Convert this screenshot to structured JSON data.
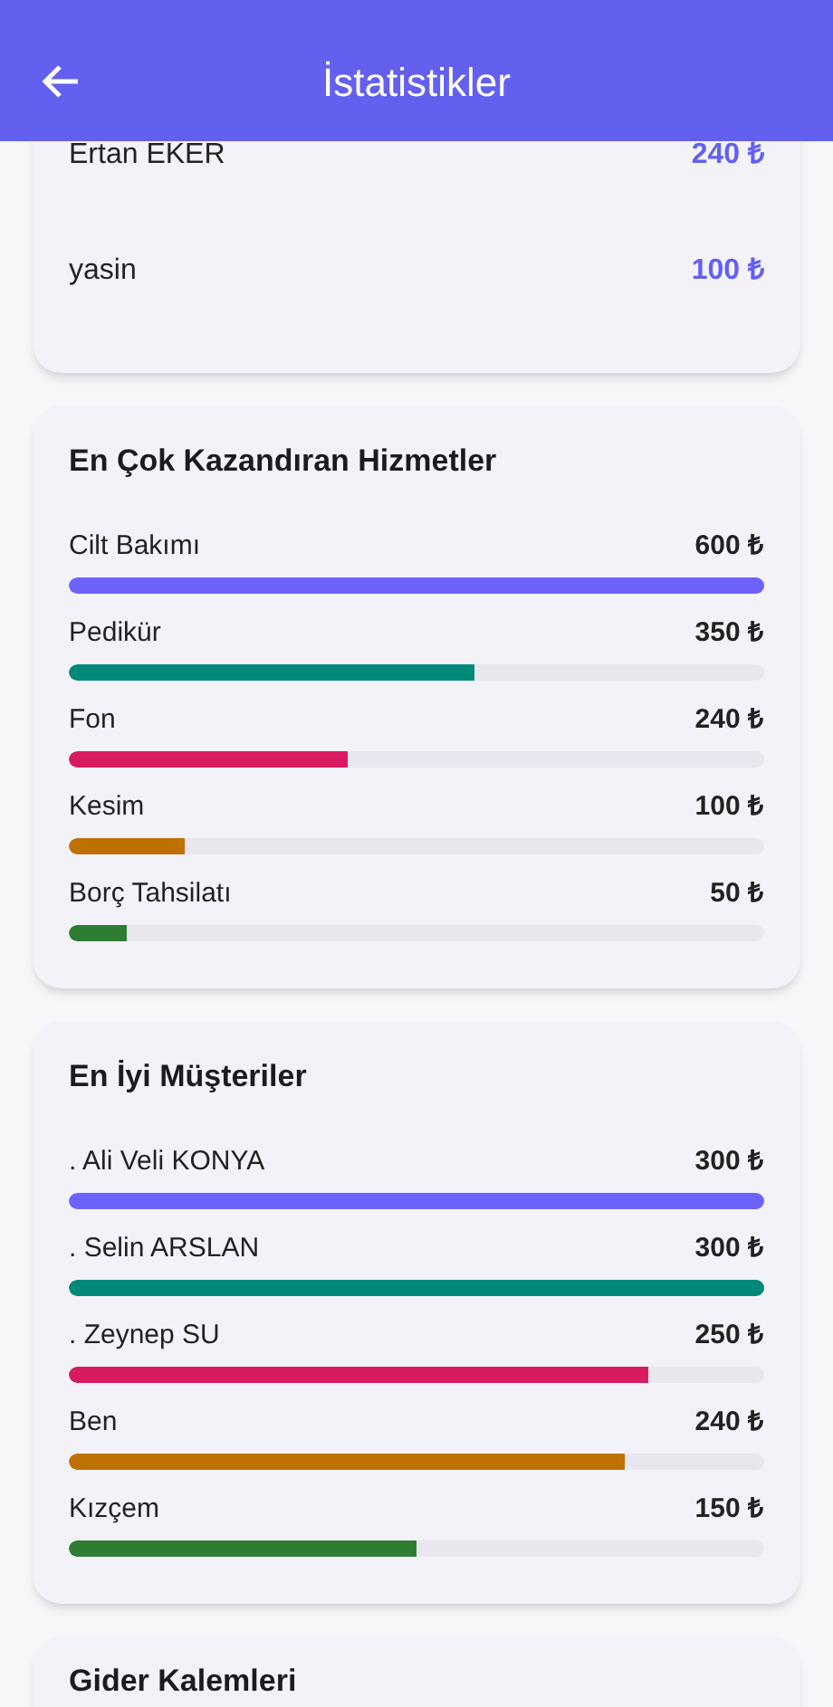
{
  "app_bar": {
    "title": "İstatistikler"
  },
  "top_employees": [
    {
      "name": "Ertan EKER",
      "amount": "240 ₺"
    },
    {
      "name": "yasin",
      "amount": "100 ₺"
    }
  ],
  "top_services": {
    "title": "En Çok Kazandıran Hizmetler",
    "items": [
      {
        "name": "Cilt Bakımı",
        "amount": "600 ₺",
        "level": 1,
        "color": "#6c63ff"
      },
      {
        "name": "Pedikür",
        "amount": "350 ₺",
        "level": 0.583,
        "color": "#00897b"
      },
      {
        "name": "Fon",
        "amount": "240 ₺",
        "level": 0.4,
        "color": "#d81b60"
      },
      {
        "name": "Kesim",
        "amount": "100 ₺",
        "level": 0.167,
        "color": "#bf7100"
      },
      {
        "name": "Borç Tahsilatı",
        "amount": "50 ₺",
        "level": 0.083,
        "color": "#2e7d32"
      }
    ]
  },
  "top_customers": {
    "title": "En İyi Müşteriler",
    "items": [
      {
        "name": ". Ali Veli KONYA",
        "amount": "300 ₺",
        "level": 1,
        "color": "#6c63ff"
      },
      {
        "name": ". Selin ARSLAN",
        "amount": "300 ₺",
        "level": 1,
        "color": "#00897b"
      },
      {
        "name": ". Zeynep SU",
        "amount": "250 ₺",
        "level": 0.833,
        "color": "#d81b60"
      },
      {
        "name": "Ben",
        "amount": "240 ₺",
        "level": 0.8,
        "color": "#bf7100"
      },
      {
        "name": "Kızçem",
        "amount": "150 ₺",
        "level": 0.5,
        "color": "#2e7d32"
      }
    ]
  },
  "expenses": {
    "title": "Gider Kalemleri"
  }
}
